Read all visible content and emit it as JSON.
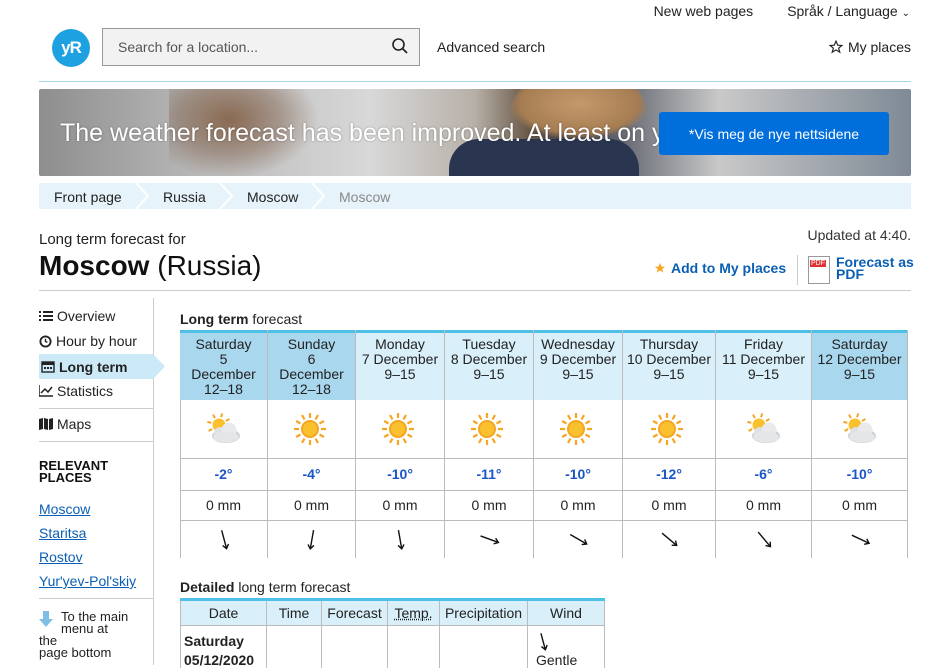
{
  "header": {
    "top_links": [
      "New web pages",
      "Språk / Language"
    ],
    "logo_text": "yR",
    "search_placeholder": "Search for a location...",
    "advanced_search": "Advanced search",
    "my_places": "My places"
  },
  "banner": {
    "headline": "The weather forecast has been improved. At least on y",
    "cta": "*Vis meg de nye nettsidene"
  },
  "breadcrumb": [
    "Front page",
    "Russia",
    "Moscow",
    "Moscow"
  ],
  "page": {
    "subtitle": "Long term forecast for",
    "place": "Moscow",
    "country": "(Russia)",
    "updated": "Updated at 4:40.",
    "add_to_places": "Add to My places",
    "pdf_badge": "PDF",
    "pdf_label_1": "Forecast as",
    "pdf_label_2": "PDF"
  },
  "sidebar": {
    "items": [
      {
        "label": "Overview",
        "icon": "list-icon"
      },
      {
        "label": "Hour by hour",
        "icon": "clock-icon"
      },
      {
        "label": "Long term",
        "icon": "calendar-icon",
        "active": true
      },
      {
        "label": "Statistics",
        "icon": "chart-icon"
      },
      {
        "label": "Maps",
        "icon": "map-icon"
      }
    ],
    "relevant_header_1": "RELEVANT",
    "relevant_header_2": "PLACES",
    "relevant_places": [
      "Moscow",
      "Staritsa",
      "Rostov",
      "Yur'yev-Pol'skiy"
    ],
    "to_main_1": "To the main",
    "to_main_2": "menu at the",
    "to_main_3": "page bottom"
  },
  "forecast": {
    "heading_bold": "Long term",
    "heading_rest": " forecast",
    "days": [
      {
        "line1": "Saturday",
        "line2": "5",
        "line3": "December",
        "time": "12–18",
        "temp": "-2°",
        "precip": "0 mm",
        "symbol": "partly-cloudy",
        "wind_deg": 165,
        "shade": "dark"
      },
      {
        "line1": "Sunday",
        "line2": "6",
        "line3": "December",
        "time": "12–18",
        "temp": "-4°",
        "precip": "0 mm",
        "symbol": "sun",
        "wind_deg": 190,
        "shade": "dark"
      },
      {
        "line1": "Monday",
        "line2": "7 December",
        "line3": "",
        "time": "9–15",
        "temp": "-10°",
        "precip": "0 mm",
        "symbol": "sun",
        "wind_deg": 170,
        "shade": "light"
      },
      {
        "line1": "Tuesday",
        "line2": "8 December",
        "line3": "",
        "time": "9–15",
        "temp": "-11°",
        "precip": "0 mm",
        "symbol": "sun",
        "wind_deg": 110,
        "shade": "light"
      },
      {
        "line1": "Wednesday",
        "line2": "9 December",
        "line3": "",
        "time": "9–15",
        "temp": "-10°",
        "precip": "0 mm",
        "symbol": "sun",
        "wind_deg": 120,
        "shade": "light"
      },
      {
        "line1": "Thursday",
        "line2": "10 December",
        "line3": "",
        "time": "9–15",
        "temp": "-12°",
        "precip": "0 mm",
        "symbol": "sun",
        "wind_deg": 130,
        "shade": "light"
      },
      {
        "line1": "Friday",
        "line2": "11 December",
        "line3": "",
        "time": "9–15",
        "temp": "-6°",
        "precip": "0 mm",
        "symbol": "partly-cloudy",
        "wind_deg": 140,
        "shade": "light"
      },
      {
        "line1": "Saturday",
        "line2": "12 December",
        "line3": "",
        "time": "9–15",
        "temp": "-10°",
        "precip": "0 mm",
        "symbol": "partly-cloudy",
        "wind_deg": 115,
        "shade": "dark"
      }
    ]
  },
  "detailed": {
    "heading_bold": "Detailed",
    "heading_rest": " long term forecast",
    "columns": [
      "Date",
      "Time",
      "Forecast",
      "Temp.",
      "Precipitation",
      "Wind"
    ],
    "first_row": {
      "day": "Saturday",
      "date": "05/12/2020",
      "wind_text": "Gentle",
      "wind_deg": 165
    }
  },
  "colors": {
    "accent": "#1ea1e1",
    "link": "#0a5fb4",
    "temp": "#1a56c8",
    "header_dark": "#a9d7ee",
    "header_light": "#d9eff9"
  }
}
